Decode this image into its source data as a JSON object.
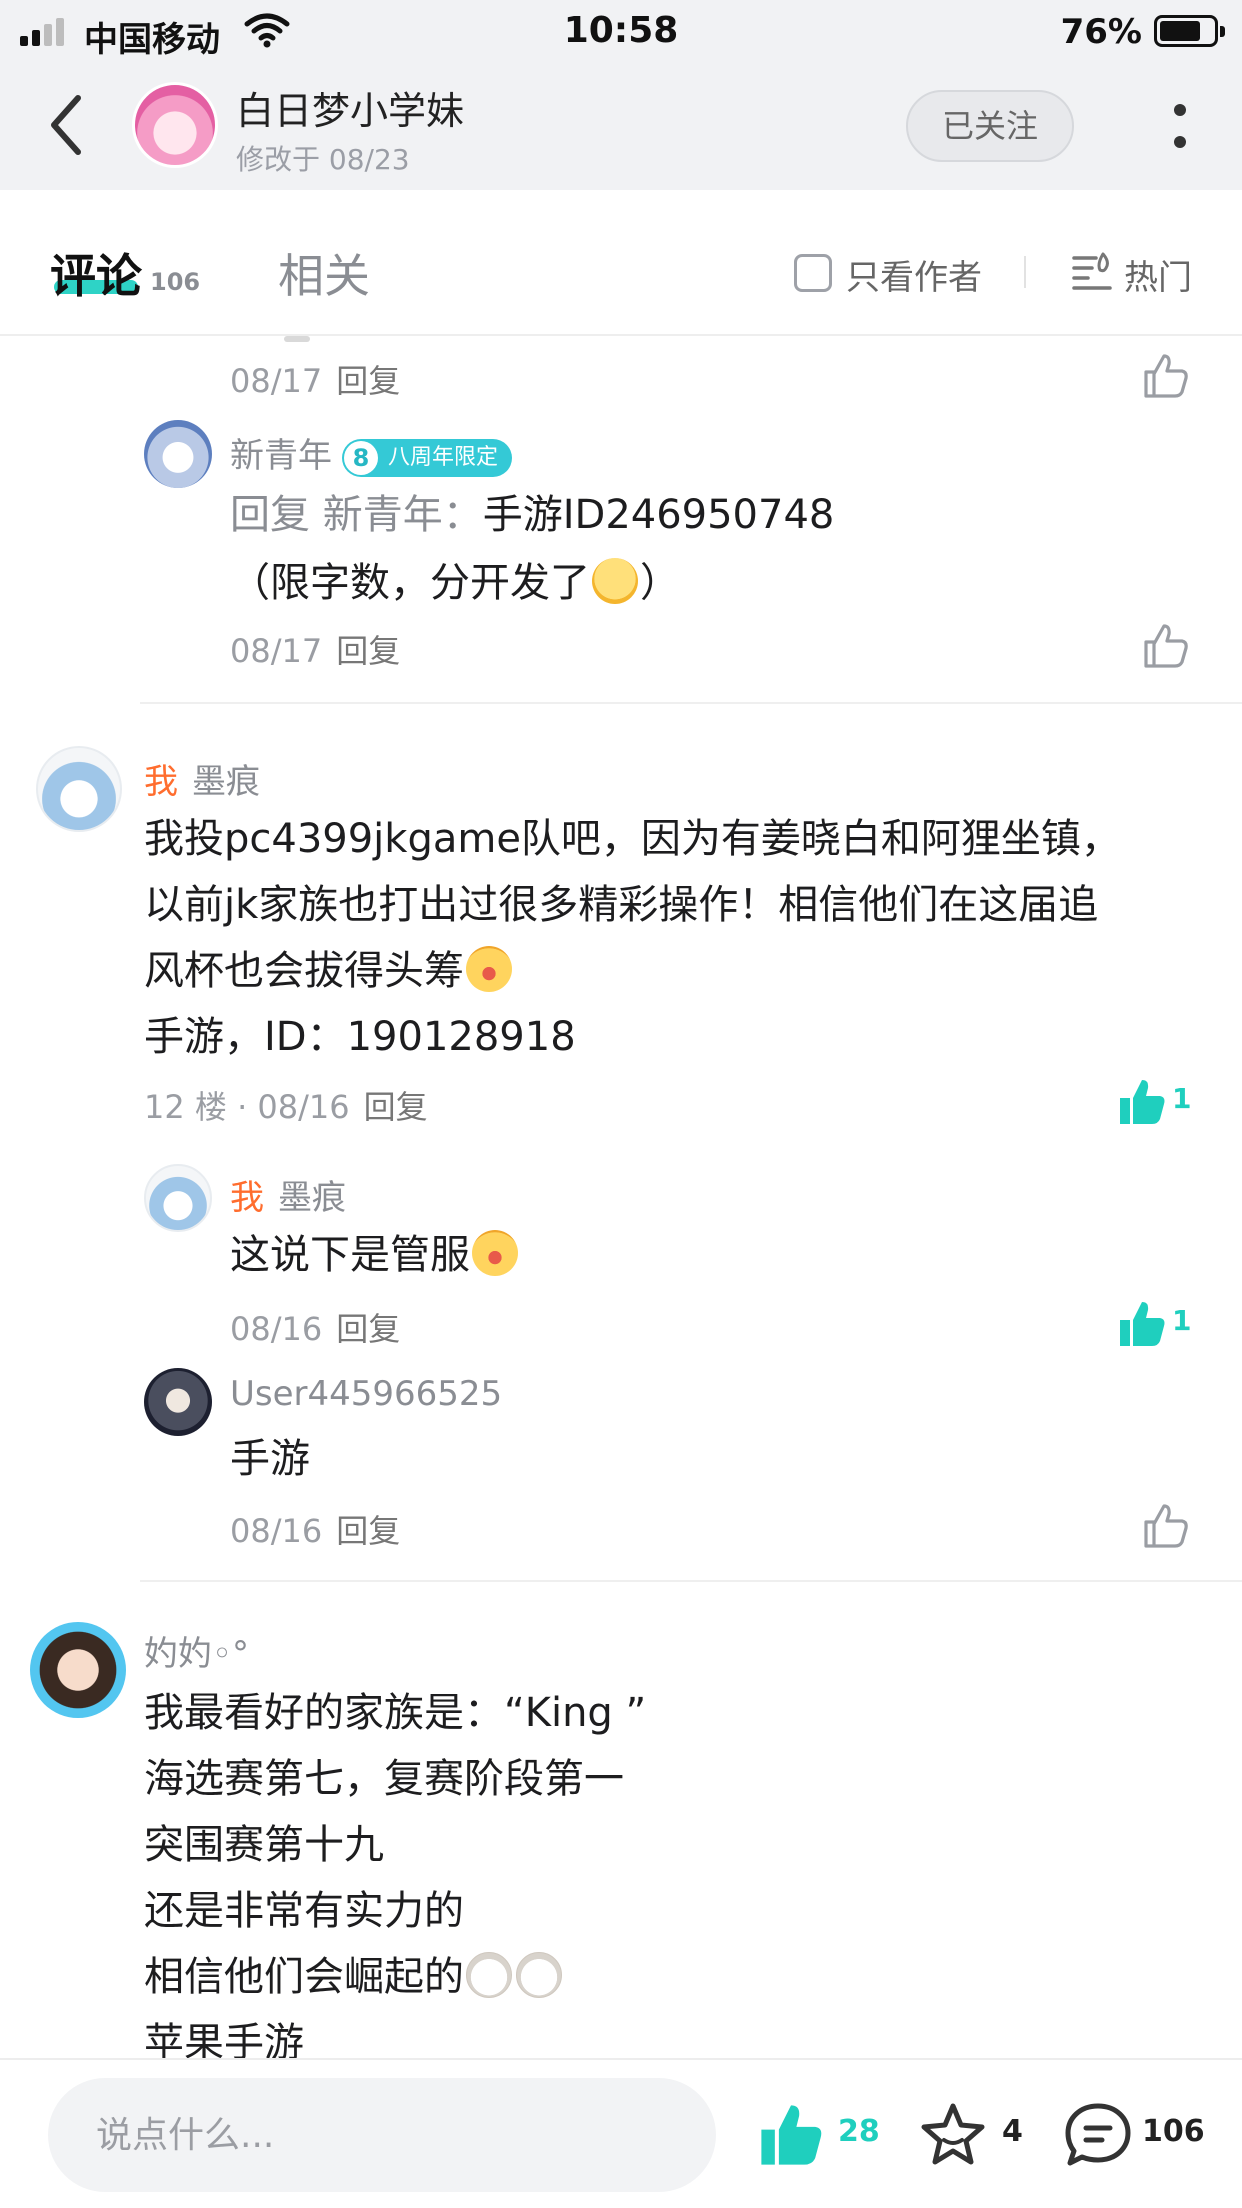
{
  "status_bar": {
    "carrier": "中国移动",
    "time": "10:58",
    "battery": "76%",
    "battery_level": 0.76
  },
  "header": {
    "author_name": "白日梦小学妹",
    "modified": "修改于 08/23",
    "follow_label": "已关注",
    "icons": {
      "back": "chevron-left-icon",
      "more": "more-vertical-icon"
    }
  },
  "tabs": {
    "comments_label": "评论",
    "comments_count": "106",
    "related_label": "相关",
    "only_author_label": "只看作者",
    "sort_label": "热门"
  },
  "comments": {
    "fragment": {
      "date": "08/17",
      "reply": "回复"
    },
    "reply1": {
      "user": "新青年",
      "badge_number": "8",
      "badge_text": "八周年限定",
      "reply_prefix": "回复 新青年：",
      "line1": "手游ID246950748",
      "line2": "（限字数，分开发了",
      "line2_end": "）",
      "date": "08/17",
      "reply": "回复"
    },
    "c12": {
      "me_tag": "我",
      "user": "墨痕",
      "lines": [
        "我投pc4399jkgame队吧，因为有姜晓白和阿狸坐镇，",
        "以前jk家族也打出过很多精彩操作！相信他们在这届追",
        "风杯也会拔得头筹",
        "手游，ID：190128918"
      ],
      "meta": "12 楼 · 08/16",
      "reply": "回复",
      "likes": "1"
    },
    "c12_reply1": {
      "me_tag": "我",
      "user": "墨痕",
      "text": "这说下是管服",
      "date": "08/16",
      "reply": "回复",
      "likes": "1"
    },
    "c12_reply2": {
      "user": "User445966525",
      "text": "手游",
      "date": "08/16",
      "reply": "回复"
    },
    "c13": {
      "user": "妁妁◦°",
      "lines": [
        "我最看好的家族是：“King ”",
        "海选赛第七，复赛阶段第一",
        "突围赛第十九",
        "还是非常有实力的",
        "相信他们会崛起的",
        "苹果手游"
      ]
    }
  },
  "bottom_bar": {
    "input_placeholder": "说点什么...",
    "likes": "28",
    "favorites": "4",
    "comments": "106"
  },
  "colors": {
    "accent": "#2ed3c6",
    "like_active": "#1fcfbe",
    "me_tag": "#ff6d2e",
    "badge": "#34c9d6"
  }
}
